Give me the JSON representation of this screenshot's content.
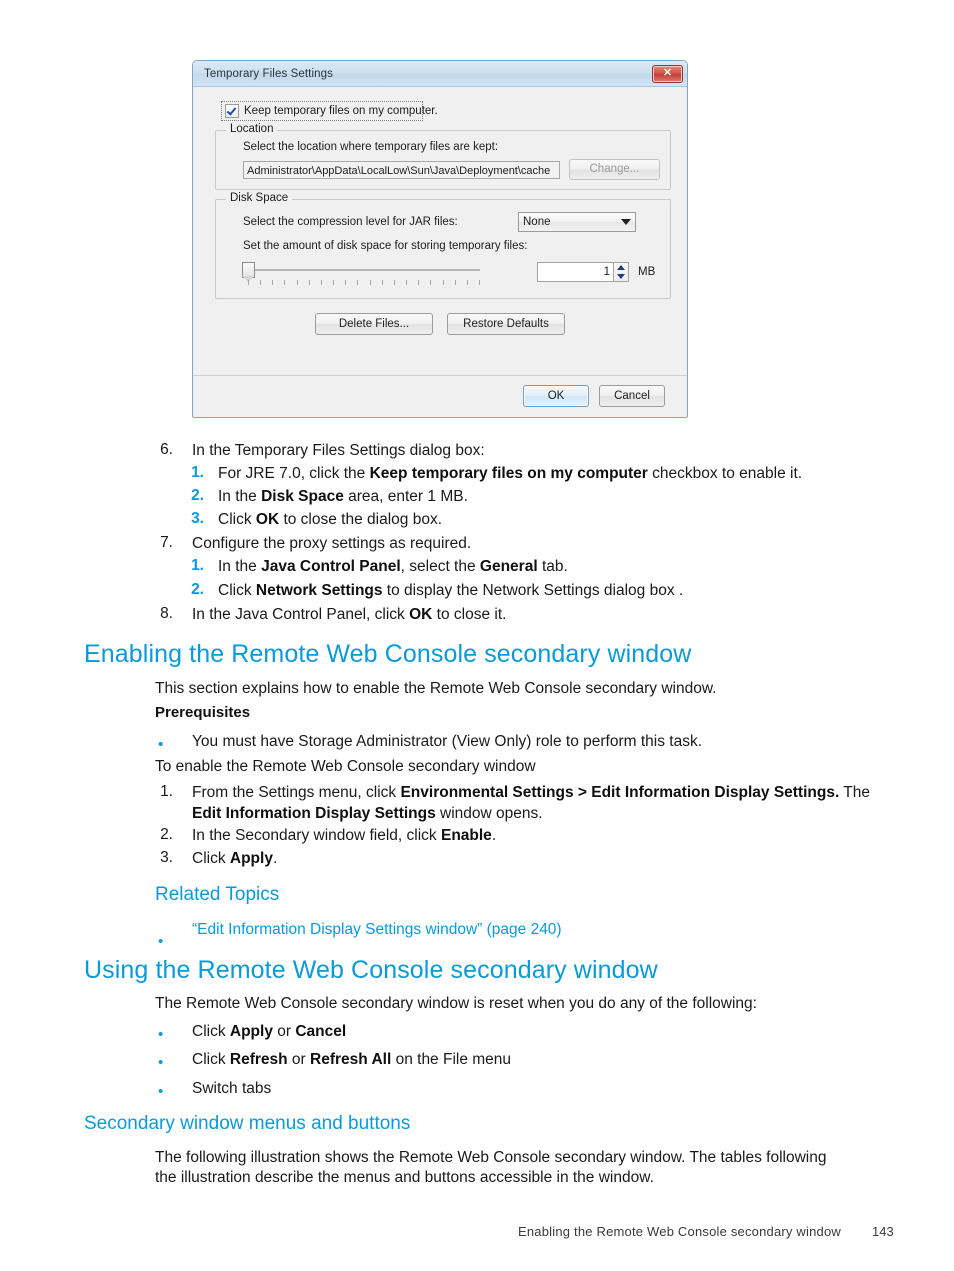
{
  "dialog": {
    "title": "Temporary Files Settings",
    "close_label": "✕",
    "checkbox_label": "Keep temporary files on my computer.",
    "location": {
      "group_title": "Location",
      "description": "Select the location where temporary files are kept:",
      "path_value": "Administrator\\AppData\\LocalLow\\Sun\\Java\\Deployment\\cache",
      "change_label": "Change..."
    },
    "disk_space": {
      "group_title": "Disk Space",
      "compression_label": "Select the compression level for JAR files:",
      "compression_value": "None",
      "amount_label": "Set the amount of disk space for storing temporary files:",
      "amount_value": "1",
      "unit": "MB"
    },
    "buttons": {
      "delete_files": "Delete Files...",
      "restore_defaults": "Restore Defaults",
      "ok": "OK",
      "cancel": "Cancel"
    }
  },
  "document": {
    "step6": {
      "number": "6.",
      "text": "In the Temporary Files Settings dialog box:",
      "substeps": [
        {
          "number": "1.",
          "pre": "For JRE 7.0, click the ",
          "bold": "Keep temporary files on my computer",
          "post": " checkbox to enable it."
        },
        {
          "number": "2.",
          "pre": "In the ",
          "bold": "Disk Space",
          "post": " area, enter 1 MB."
        },
        {
          "number": "3.",
          "pre": "Click ",
          "bold": "OK",
          "post": " to close the dialog box."
        }
      ]
    },
    "step7": {
      "number": "7.",
      "text": "Configure the proxy settings as required.",
      "substeps": [
        {
          "number": "1.",
          "pre": "In the ",
          "bold": "Java Control Panel",
          "mid": ", select the ",
          "bold2": "General",
          "post": " tab."
        },
        {
          "number": "2.",
          "pre": "Click ",
          "bold": "Network Settings",
          "post": " to display the Network Settings dialog box ."
        }
      ]
    },
    "step8": {
      "number": "8.",
      "pre": "In the Java Control Panel, click ",
      "bold": "OK",
      "post": " to close it."
    },
    "heading_enabling": "Enabling the Remote Web Console secondary window",
    "intro_enabling": "This section explains how to enable the Remote Web Console secondary window.",
    "prerequisites_label": "Prerequisites",
    "prerequisite_item": "You must have Storage Administrator (View Only) role to perform this task.",
    "to_enable_label": "To enable the Remote Web Console secondary window",
    "enable_steps": [
      {
        "number": "1.",
        "pre": "From the Settings menu, click ",
        "bold": "Environmental Settings > Edit Information Display Settings.",
        "mid": " The ",
        "bold2": "Edit Information Display Settings",
        "post": " window opens."
      },
      {
        "number": "2.",
        "pre": "In the Secondary window field, click ",
        "bold": "Enable",
        "post": "."
      },
      {
        "number": "3.",
        "pre": "Click ",
        "bold": "Apply",
        "post": "."
      }
    ],
    "related_topics_heading": "Related Topics",
    "related_topic_link": "“Edit Information Display Settings window” (page 240)",
    "heading_using": "Using the Remote Web Console secondary window",
    "intro_using": "The Remote Web Console secondary window is reset when you do any of the following:",
    "using_items": [
      {
        "pre": "Click ",
        "bold": "Apply",
        "mid": " or ",
        "bold2": "Cancel",
        "post": ""
      },
      {
        "pre": "Click ",
        "bold": "Refresh",
        "mid": " or ",
        "bold2": "Refresh All",
        "post": " on the File menu"
      },
      {
        "pre": "Switch tabs",
        "bold": "",
        "mid": "",
        "bold2": "",
        "post": ""
      }
    ],
    "heading_menus": "Secondary window menus and buttons",
    "menus_paragraph_line1": "The following illustration shows the Remote Web Console secondary window. The tables following",
    "menus_paragraph_line2": "the illustration describe the menus and buttons accessible in the window."
  },
  "footer": {
    "text": "Enabling the Remote Web Console secondary window",
    "page": "143"
  },
  "colors": {
    "heading_blue": "#0b9ad8",
    "link_blue": "#0b9ad8",
    "body_text": "#1a1a1a"
  }
}
